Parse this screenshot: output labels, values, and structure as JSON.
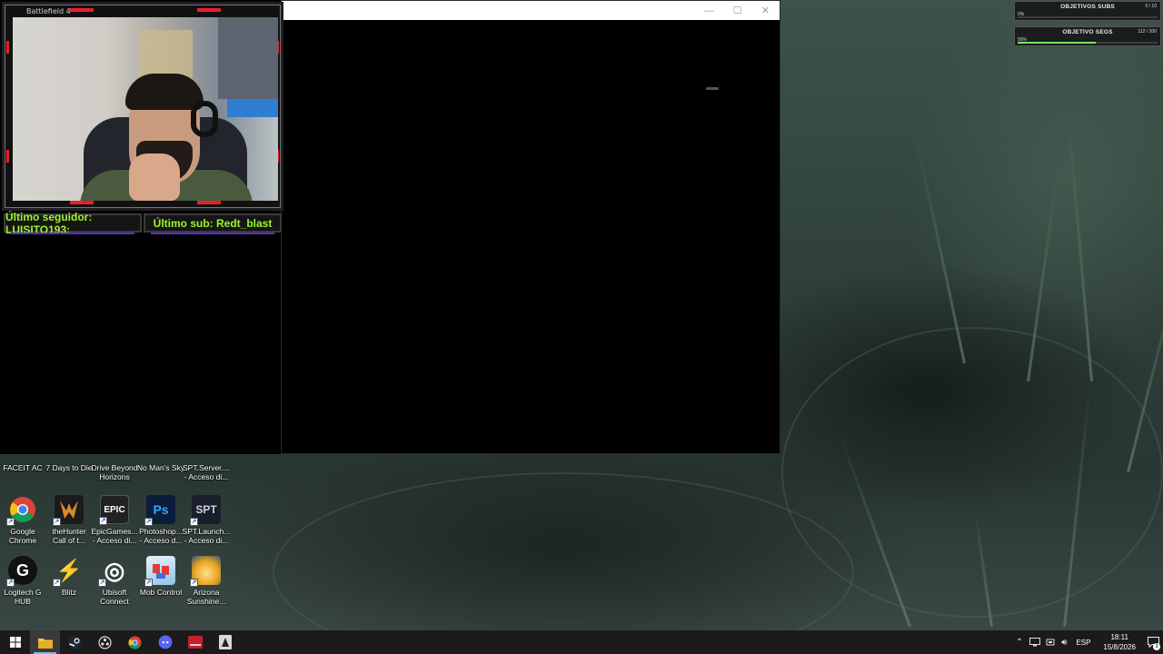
{
  "game_window": {
    "title": "",
    "minimize": "—",
    "maximize": "☐",
    "close": "✕"
  },
  "webcam": {
    "title": "Battlefield 4",
    "latest_follower": "Último seguidor: LUISITO193:",
    "latest_sub": "Último sub: Redt_blast"
  },
  "goals": [
    {
      "title": "OBJETIVOS SUBS",
      "count": "0 / 10",
      "percent_label": "0%",
      "progress": 0.0
    },
    {
      "title": "OBJETIVO SEGS",
      "count": "112 / 200",
      "percent_label": "56%",
      "progress": 0.56
    }
  ],
  "desktop_top_row": [
    "FACEIT AC",
    "7 Days to Die",
    "Drive Beyond\nHorizons",
    "No Man's Sky",
    "SPT.Server....\n- Acceso di..."
  ],
  "desktop_icons": [
    {
      "name": "google-chrome",
      "label": "Google\nChrome",
      "glyph": "",
      "color": "#ffffff"
    },
    {
      "name": "thehunter",
      "label": "theHunter\nCall of t...",
      "glyph": "",
      "color": "#d98a2b"
    },
    {
      "name": "epic-games",
      "label": "EpicGames...\n- Acceso di...",
      "glyph": "EPIC",
      "color": "#222222"
    },
    {
      "name": "photoshop",
      "label": "Photoshop...\n- Acceso d...",
      "glyph": "Ps",
      "color": "#0b1d3a"
    },
    {
      "name": "spt-launcher",
      "label": "SPT.Launch...\n- Acceso di...",
      "glyph": "SPT",
      "color": "#1a1e2a"
    },
    {
      "name": "logitech-ghub",
      "label": "Logitech G\nHUB",
      "glyph": "G",
      "color": "#111111"
    },
    {
      "name": "blitz",
      "label": "Blitz",
      "glyph": "⚡",
      "color": "#00000000"
    },
    {
      "name": "ubisoft-connect",
      "label": "Ubisoft\nConnect",
      "glyph": "◎",
      "color": "#101010"
    },
    {
      "name": "mob-control",
      "label": "Mob Control",
      "glyph": "",
      "color": "#d9e8f2"
    },
    {
      "name": "arizona-sunshine",
      "label": "Arizona\nSunshine...",
      "glyph": "",
      "color": "#e8b23a"
    }
  ],
  "taskbar": {
    "apps": [
      "windows-start",
      "file-explorer",
      "steam",
      "obs",
      "chrome",
      "discord",
      "streamer-app",
      "battlefield"
    ],
    "language": "ESP",
    "time": "18:11",
    "date": "15/8/2026",
    "notifications": "3"
  }
}
